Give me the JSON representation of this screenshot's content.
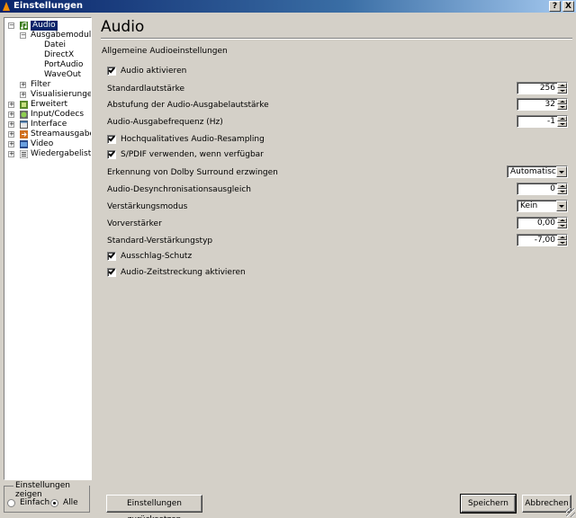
{
  "window": {
    "title": "Einstellungen",
    "help_label": "?",
    "close_label": "X"
  },
  "tree": {
    "audio": "Audio",
    "ausgabemodule": "Ausgabemodule",
    "datei": "Datei",
    "directx": "DirectX",
    "portaudio": "PortAudio",
    "waveout": "WaveOut",
    "filter": "Filter",
    "visualisierungen": "Visualisierungen",
    "erweitert": "Erweitert",
    "input_codecs": "Input/Codecs",
    "interface": "Interface",
    "streamausgabe": "Streamausgabe",
    "video": "Video",
    "wiedergabeliste": "Wiedergabeliste"
  },
  "show_settings": {
    "label": "Einstellungen zeigen",
    "simple": "Einfach",
    "all": "Alle",
    "selected": "all"
  },
  "panel": {
    "title": "Audio",
    "subtitle": "Allgemeine Audioeinstellungen",
    "audio_enable": {
      "label": "Audio aktivieren",
      "checked": true
    },
    "default_volume": {
      "label": "Standardlautstärke",
      "value": "256"
    },
    "volume_step": {
      "label": "Abstufung der Audio-Ausgabelautstärke",
      "value": "32"
    },
    "output_freq": {
      "label": "Audio-Ausgabefrequenz (Hz)",
      "value": "-1"
    },
    "hq_resampling": {
      "label": "Hochqualitatives Audio-Resampling",
      "checked": true
    },
    "spdif": {
      "label": "S/PDIF verwenden, wenn verfügbar",
      "checked": true
    },
    "dolby": {
      "label": "Erkennung von Dolby Surround erzwingen",
      "value": "Automatisch"
    },
    "desync": {
      "label": "Audio-Desynchronisationsausgleich",
      "value": "0"
    },
    "gain_mode": {
      "label": "Verstärkungsmodus",
      "value": "Kein"
    },
    "preamp": {
      "label": "Vorverstärker",
      "value": "0,00"
    },
    "default_gain_type": {
      "label": "Standard-Verstärkungstyp",
      "value": "-7,00"
    },
    "clip_protect": {
      "label": "Ausschlag-Schutz",
      "checked": true
    },
    "time_stretch": {
      "label": "Audio-Zeitstreckung aktivieren",
      "checked": true
    }
  },
  "buttons": {
    "reset": "Einstellungen zurücksetzen",
    "save": "Speichern",
    "cancel": "Abbrechen"
  }
}
